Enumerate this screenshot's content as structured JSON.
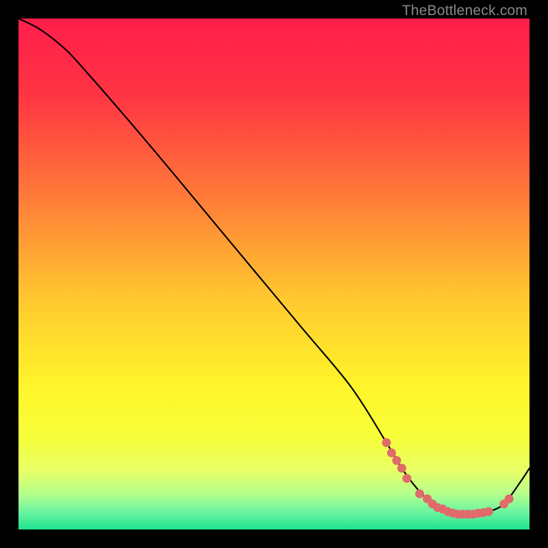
{
  "attribution": "TheBottleneck.com",
  "chart_data": {
    "type": "line",
    "title": "",
    "xlabel": "",
    "ylabel": "",
    "xlim": [
      0,
      100
    ],
    "ylim": [
      0,
      100
    ],
    "grid": false,
    "legend": false,
    "series": [
      {
        "name": "bottleneck-curve",
        "x": [
          0,
          4,
          8,
          12,
          25,
          40,
          55,
          65,
          72,
          75,
          78,
          80,
          83,
          86,
          89,
          92,
          95,
          98,
          100
        ],
        "values": [
          100,
          98,
          95,
          91,
          76,
          58,
          40,
          28,
          17,
          12,
          8,
          6,
          4,
          3,
          3,
          3.5,
          5,
          9,
          12
        ],
        "color": "#000000"
      }
    ],
    "markers": {
      "name": "highlighted-range",
      "color": "#E06B6B",
      "points": [
        {
          "x": 72,
          "y": 17
        },
        {
          "x": 73,
          "y": 15
        },
        {
          "x": 74,
          "y": 13.5
        },
        {
          "x": 75,
          "y": 12
        },
        {
          "x": 76,
          "y": 10
        },
        {
          "x": 78.5,
          "y": 7
        },
        {
          "x": 80,
          "y": 6
        },
        {
          "x": 81,
          "y": 5
        },
        {
          "x": 82,
          "y": 4.3
        },
        {
          "x": 83,
          "y": 4
        },
        {
          "x": 84,
          "y": 3.5
        },
        {
          "x": 85,
          "y": 3.2
        },
        {
          "x": 86,
          "y": 3
        },
        {
          "x": 87,
          "y": 3
        },
        {
          "x": 88,
          "y": 3
        },
        {
          "x": 89,
          "y": 3
        },
        {
          "x": 90,
          "y": 3.2
        },
        {
          "x": 91,
          "y": 3.3
        },
        {
          "x": 92,
          "y": 3.5
        },
        {
          "x": 95,
          "y": 5
        },
        {
          "x": 96,
          "y": 6
        }
      ]
    },
    "background_gradient": {
      "type": "vertical",
      "stops": [
        {
          "offset": 0.0,
          "color": "#FF1E4B"
        },
        {
          "offset": 0.15,
          "color": "#FF3443"
        },
        {
          "offset": 0.35,
          "color": "#FF7B38"
        },
        {
          "offset": 0.55,
          "color": "#FFC92F"
        },
        {
          "offset": 0.72,
          "color": "#FFF52A"
        },
        {
          "offset": 0.82,
          "color": "#F7FF3A"
        },
        {
          "offset": 0.885,
          "color": "#E8FF66"
        },
        {
          "offset": 0.93,
          "color": "#B6FF8C"
        },
        {
          "offset": 0.965,
          "color": "#6CF5A0"
        },
        {
          "offset": 1.0,
          "color": "#1FE28E"
        }
      ]
    }
  }
}
